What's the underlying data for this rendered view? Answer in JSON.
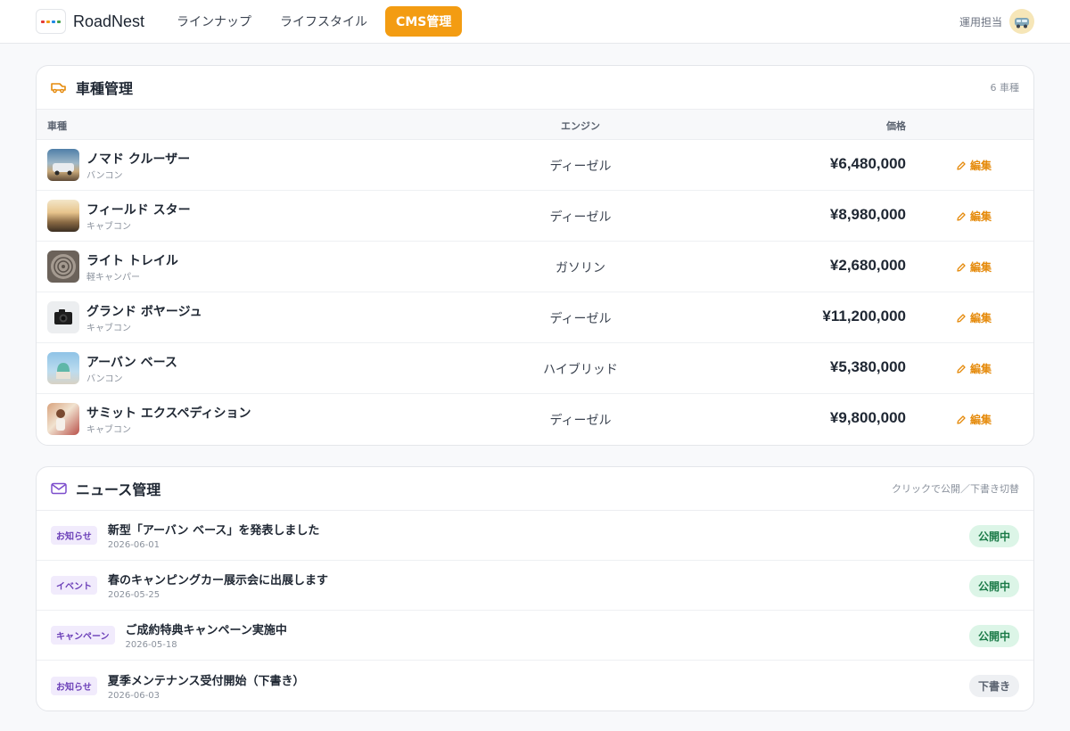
{
  "app": {
    "brand": "RoadNest",
    "nav": [
      {
        "label": "ラインナップ",
        "active": false
      },
      {
        "label": "ライフスタイル",
        "active": false
      },
      {
        "label": "CMS管理",
        "active": true
      }
    ],
    "user_label": "運用担当"
  },
  "vehicles": {
    "title": "車種管理",
    "count_label": "6 車種",
    "columns": {
      "name": "車種",
      "engine": "エンジン",
      "price": "価格"
    },
    "edit_label": "編集",
    "rows": [
      {
        "name": "ノマド クルーザー",
        "type": "バンコン",
        "engine": "ディーゼル",
        "price": "¥6,480,000"
      },
      {
        "name": "フィールド スター",
        "type": "キャブコン",
        "engine": "ディーゼル",
        "price": "¥8,980,000"
      },
      {
        "name": "ライト トレイル",
        "type": "軽キャンパー",
        "engine": "ガソリン",
        "price": "¥2,680,000"
      },
      {
        "name": "グランド ボヤージュ",
        "type": "キャブコン",
        "engine": "ディーゼル",
        "price": "¥11,200,000"
      },
      {
        "name": "アーバン ベース",
        "type": "バンコン",
        "engine": "ハイブリッド",
        "price": "¥5,380,000"
      },
      {
        "name": "サミット エクスペディション",
        "type": "キャブコン",
        "engine": "ディーゼル",
        "price": "¥9,800,000"
      }
    ]
  },
  "news": {
    "title": "ニュース管理",
    "hint": "クリックで公開／下書き切替",
    "items": [
      {
        "tag": "お知らせ",
        "title": "新型「アーバン ベース」を発表しました",
        "date": "2026-06-01",
        "status": "公開中"
      },
      {
        "tag": "イベント",
        "title": "春のキャンピングカー展示会に出展します",
        "date": "2026-05-25",
        "status": "公開中"
      },
      {
        "tag": "キャンペーン",
        "title": "ご成約特典キャンペーン実施中",
        "date": "2026-05-18",
        "status": "公開中"
      },
      {
        "tag": "お知らせ",
        "title": "夏季メンテナンス受付開始（下書き）",
        "date": "2026-06-03",
        "status": "下書き"
      }
    ]
  },
  "colors": {
    "accent": "#f39c12",
    "edit": "#e58a0b",
    "tag_text": "#6b3fb8",
    "published": "#1a7a47",
    "draft": "#5b6370"
  }
}
